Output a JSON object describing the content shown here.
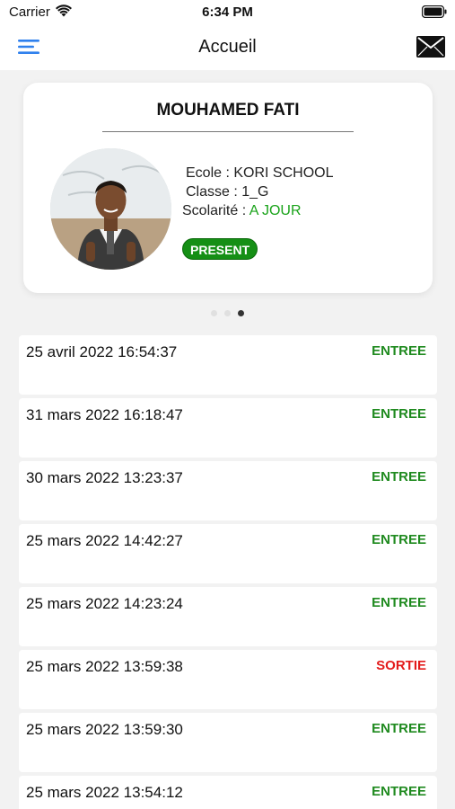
{
  "status_bar": {
    "carrier": "Carrier",
    "time": "6:34 PM"
  },
  "nav": {
    "title": "Accueil",
    "menu_icon": "hamburger-menu-icon",
    "mail_icon": "envelope-icon"
  },
  "student": {
    "name": "MOUHAMED FATI",
    "school_line": "Ecole : KORI SCHOOL",
    "class_line": "Classe : 1_G",
    "schooling_label": "Scolarité : ",
    "schooling_value": "A JOUR",
    "presence": "PRESENT"
  },
  "pager": {
    "count": 3,
    "active_index": 2
  },
  "colors": {
    "accent": "#2f80ed",
    "present_badge": "#158f15",
    "entree": "#1f8a1f",
    "sortie": "#e31b1b",
    "schooling_ok": "#1aa31a"
  },
  "logs": [
    {
      "date": "25 avril 2022 16:54:37",
      "status": "ENTREE",
      "type": "in"
    },
    {
      "date": "31 mars 2022 16:18:47",
      "status": "ENTREE",
      "type": "in"
    },
    {
      "date": "30 mars 2022 13:23:37",
      "status": "ENTREE",
      "type": "in"
    },
    {
      "date": "25 mars 2022 14:42:27",
      "status": "ENTREE",
      "type": "in"
    },
    {
      "date": "25 mars 2022 14:23:24",
      "status": "ENTREE",
      "type": "in"
    },
    {
      "date": "25 mars 2022 13:59:38",
      "status": "SORTIE",
      "type": "out"
    },
    {
      "date": "25 mars 2022 13:59:30",
      "status": "ENTREE",
      "type": "in"
    },
    {
      "date": "25 mars 2022 13:54:12",
      "status": "ENTREE",
      "type": "in"
    }
  ]
}
